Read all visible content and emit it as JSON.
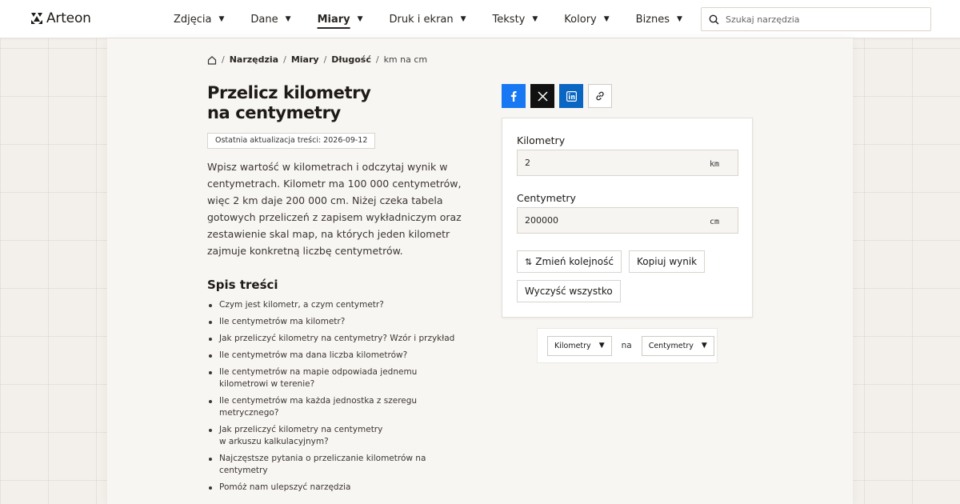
{
  "brand": {
    "name": "Arteon"
  },
  "nav": {
    "items": [
      {
        "label": "Zdjęcia"
      },
      {
        "label": "Dane"
      },
      {
        "label": "Miary"
      },
      {
        "label": "Druk i ekran"
      },
      {
        "label": "Teksty"
      },
      {
        "label": "Kolory"
      },
      {
        "label": "Biznes"
      }
    ],
    "active": "Miary"
  },
  "search": {
    "placeholder": "Szukaj narzędzia"
  },
  "breadcrumb": {
    "items": [
      "Narzędzia",
      "Miary",
      "Długość"
    ],
    "current": "km na cm"
  },
  "page": {
    "title_line1": "Przelicz kilometry",
    "title_line2": "na centymetry",
    "updated": "Ostatnia aktualizacja treści: 2026-09-12",
    "intro": "Wpisz wartość w kilometrach i odczytaj wynik w centymetrach. Kilometr ma 100 000 centymetrów, więc 2 km daje 200 000 cm. Niżej czeka tabela gotowych przeliczeń z zapisem wykładniczym oraz zestawienie skal map, na których jeden kilometr zajmuje konkretną liczbę centymetrów."
  },
  "toc": {
    "title": "Spis treści",
    "items": [
      "Czym jest kilometr, a czym centymetr?",
      "Ile centymetrów ma kilometr?",
      "Jak przeliczyć kilometry na centymetry? Wzór i przykład",
      "Ile centymetrów ma dana liczba kilometrów?",
      "Ile centymetrów na mapie odpowiada jednemu kilometrowi w terenie?",
      "Ile centymetrów ma każda jednostka z szeregu metrycznego?",
      "Jak przeliczyć kilometry na centymetry w arkuszu kalkulacyjnym?",
      "Najczęstsze pytania o przeliczanie kilometrów na centymetry",
      "Pomóż nam ulepszyć narzędzia"
    ]
  },
  "share": {
    "icons": [
      "facebook-icon",
      "x-icon",
      "linkedin-icon",
      "link-icon"
    ]
  },
  "converter": {
    "from_label": "Kilometry",
    "from_value": "2",
    "from_unit": "km",
    "to_label": "Centymetry",
    "to_value": "200000",
    "to_unit": "cm",
    "swap_label": "Zmień kolejność",
    "copy_label": "Kopiuj wynik",
    "clear_label": "Wyczyść wszystko"
  },
  "switcher": {
    "from": "Kilometry",
    "connector": "na",
    "to": "Centymetry"
  },
  "colors": {
    "facebook": "#1877f2",
    "x": "#111111",
    "linkedin": "#0a66c2",
    "background": "#f3efea"
  }
}
